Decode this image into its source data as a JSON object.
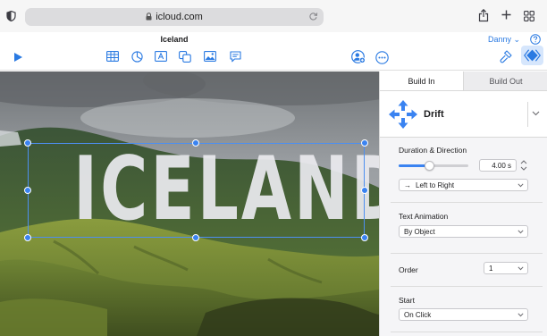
{
  "browser": {
    "url": "icloud.com"
  },
  "toolbar": {
    "document_title": "Iceland",
    "user_name": "Danny",
    "user_chevron": "⌄"
  },
  "slide": {
    "title_text": "ICELAND"
  },
  "inspector": {
    "tabs": [
      {
        "label": "Build In",
        "selected": true
      },
      {
        "label": "Build Out",
        "selected": false
      }
    ],
    "effect_name": "Drift",
    "duration_direction": {
      "label": "Duration & Direction",
      "duration_value": "4.00 s",
      "duration_fraction": 0.43,
      "direction_value": "Left to Right",
      "direction_arrow": "→"
    },
    "text_animation": {
      "label": "Text Animation",
      "value": "By Object"
    },
    "order": {
      "label": "Order",
      "value": "1"
    },
    "start": {
      "label": "Start",
      "value": "On Click"
    }
  },
  "colors": {
    "accent": "#3a83f1",
    "link": "#2a7ae2",
    "panel_background": "#f5f5f7"
  },
  "icons": {
    "browser": [
      "sidebar-icon",
      "lock-icon",
      "reload-icon",
      "share-icon",
      "plus-icon",
      "tabs-icon"
    ],
    "toolbar": [
      "play-icon",
      "table-icon",
      "chart-icon",
      "text-box-icon",
      "shape-icon",
      "media-icon",
      "comment-icon",
      "collaborate-icon",
      "more-icon",
      "format-brush-icon",
      "animate-icon",
      "help-icon"
    ],
    "inspector": [
      "drift-arrows-icon",
      "chevron-down-icon",
      "stepper-icon"
    ]
  }
}
